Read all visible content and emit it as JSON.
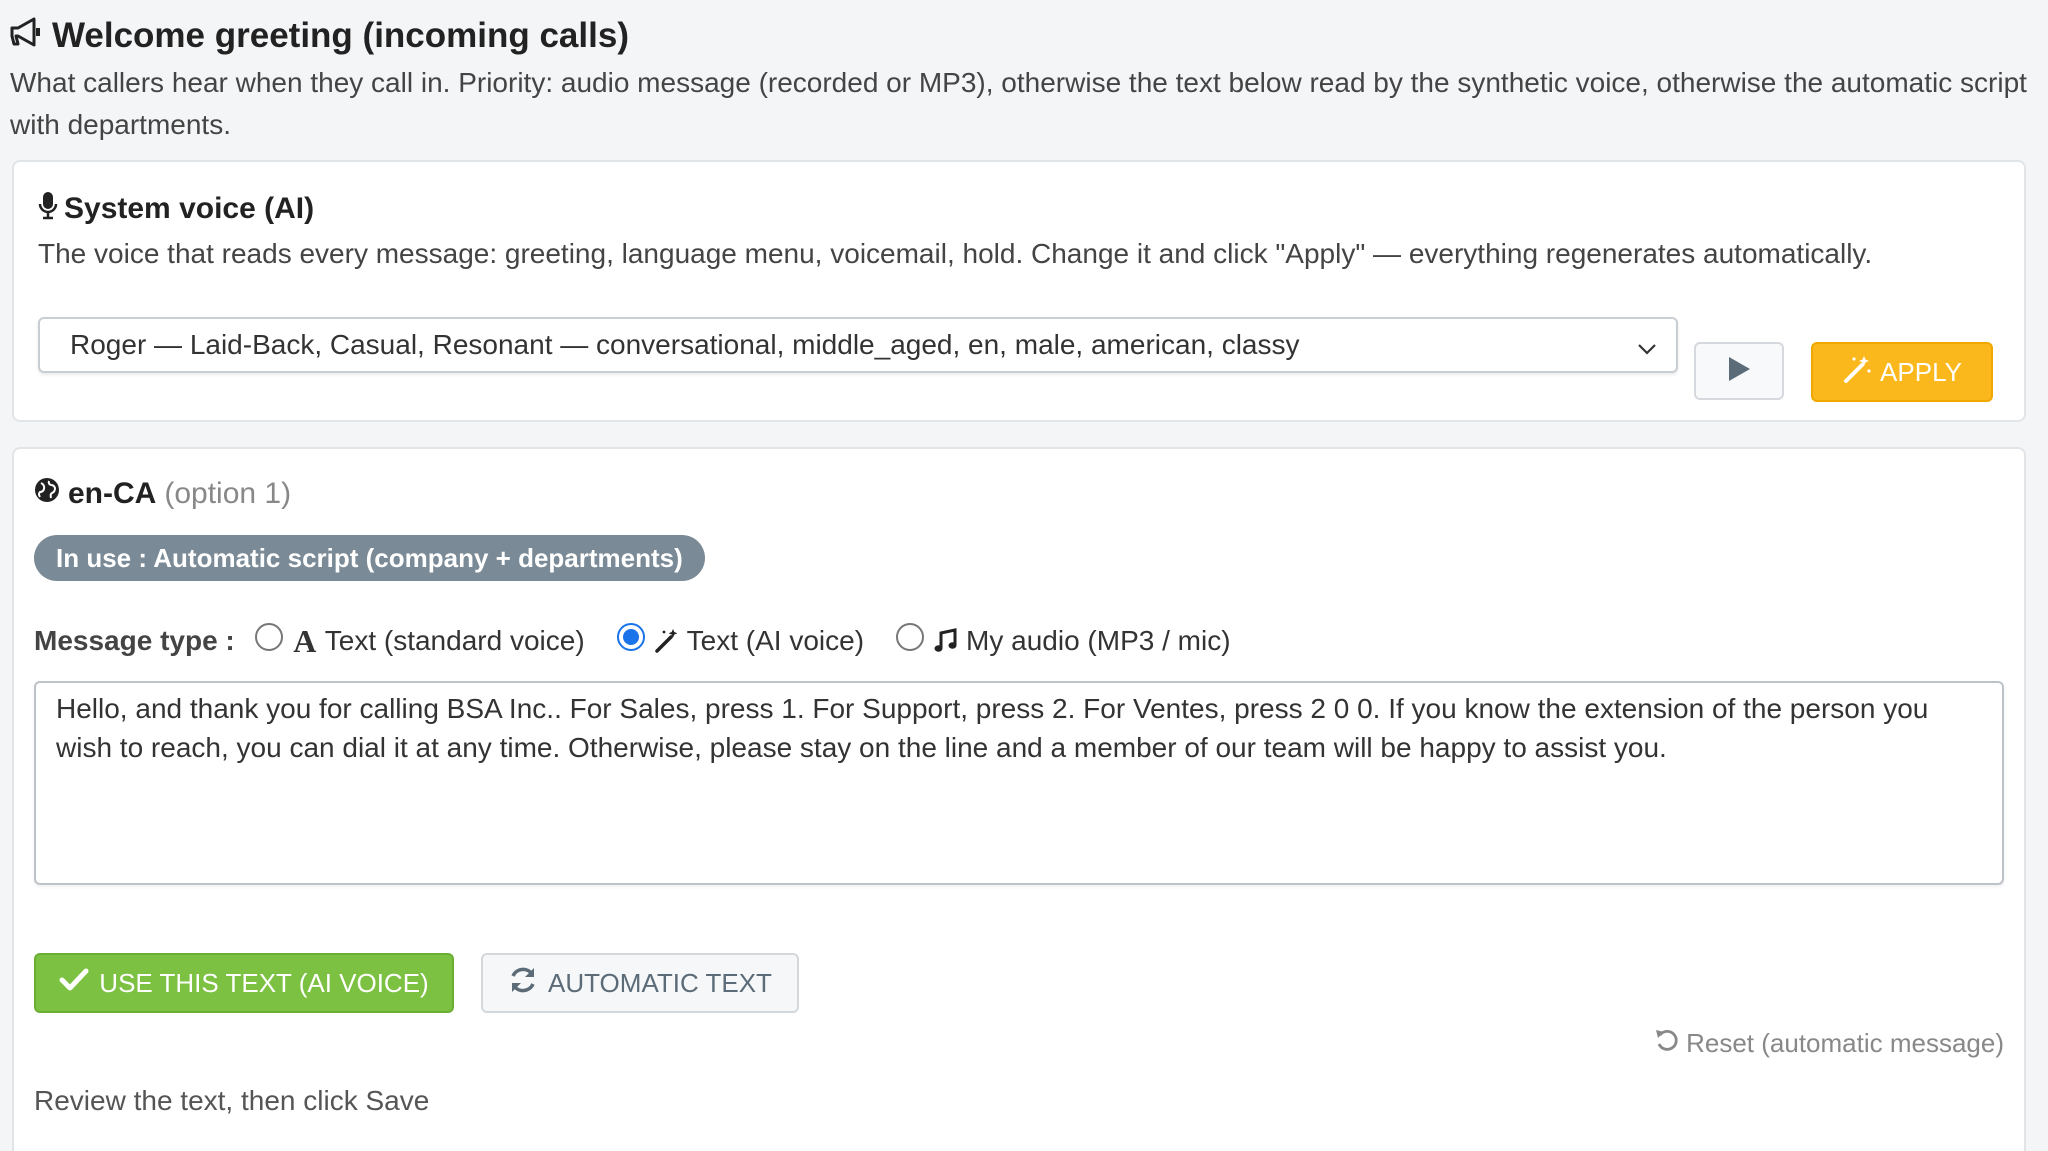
{
  "header": {
    "title": "Welcome greeting (incoming calls)",
    "subtitle": "What callers hear when they call in. Priority: audio message (recorded or MP3), otherwise the text below read by the synthetic voice, otherwise the automatic script with departments."
  },
  "voice_panel": {
    "title": "System voice (AI)",
    "description": "The voice that reads every message: greeting, language menu, voicemail, hold. Change it and click \"Apply\" — everything regenerates automatically.",
    "selected_voice": "Roger — Laid-Back, Casual, Resonant — conversational, middle_aged, en, male, american, classy",
    "apply_label": "APPLY"
  },
  "language_panel": {
    "code": "en-CA",
    "option": "(option 1)",
    "status_badge": "In use : Automatic script (company + departments)",
    "message_type_label": "Message type :",
    "options": [
      {
        "label": "Text (standard voice)",
        "selected": false
      },
      {
        "label": "Text (AI voice)",
        "selected": true
      },
      {
        "label": "My audio (MP3 / mic)",
        "selected": false
      }
    ],
    "message_text": "Hello, and thank you for calling BSA Inc.. For Sales, press 1. For Support, press 2. For Ventes, press 2 0 0. If you know the extension of the person you wish to reach, you can dial it at any time. Otherwise, please stay on the line and a member of our team will be happy to assist you.",
    "use_text_label": "USE THIS TEXT (AI VOICE)",
    "automatic_text_label": "AUTOMATIC TEXT",
    "reset_label": "Reset (automatic message)",
    "hint": "Review the text, then click Save"
  },
  "colors": {
    "apply": "#fbb81c",
    "use_text": "#7cc142",
    "badge": "#7a8a96",
    "radio_checked": "#1a73e8"
  },
  "icons": {
    "title": "bullhorn-icon",
    "voice": "microphone-icon",
    "language": "globe-icon",
    "play": "play-icon",
    "apply": "magic-wand-icon",
    "text_standard": "font-letter-icon",
    "text_ai": "magic-wand-icon",
    "audio": "music-note-icon",
    "use_text": "checkmark-icon",
    "automatic_text": "refresh-icon",
    "reset": "undo-icon"
  }
}
